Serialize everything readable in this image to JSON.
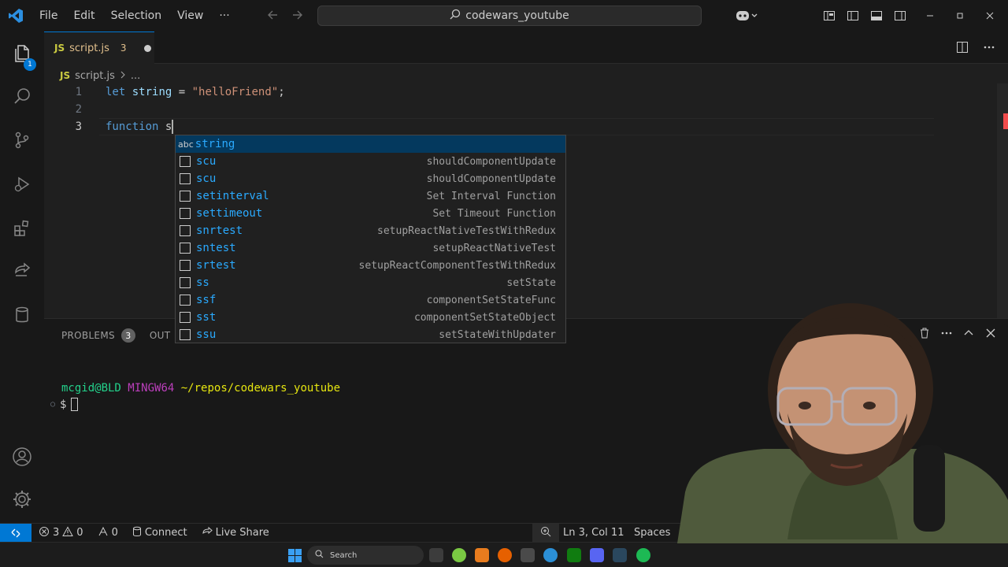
{
  "menu": {
    "file": "File",
    "edit": "Edit",
    "selection": "Selection",
    "view": "View",
    "more": "···"
  },
  "search": {
    "text": "codewars_youtube"
  },
  "activity": {
    "explorer_badge": "1"
  },
  "tab": {
    "lang": "JS",
    "name": "script.js",
    "problem_count": "3"
  },
  "breadcrumb": {
    "lang": "JS",
    "file": "script.js",
    "more": "..."
  },
  "code": {
    "lines": [
      {
        "number": "1",
        "content": ""
      },
      {
        "number": "2",
        "content": ""
      },
      {
        "number": "3",
        "content": ""
      }
    ],
    "line1": {
      "kw": "let",
      "var": "string",
      "eq": " = ",
      "str": "\"helloFriend\"",
      "end": ";"
    },
    "line3": {
      "kw": "function",
      "typed": "s"
    }
  },
  "suggest": {
    "items": [
      {
        "icon": "abc",
        "label": "string",
        "detail": ""
      },
      {
        "icon": "snippet",
        "label": "scu",
        "detail": "shouldComponentUpdate"
      },
      {
        "icon": "snippet",
        "label": "scu",
        "detail": "shouldComponentUpdate"
      },
      {
        "icon": "snippet",
        "label": "setinterval",
        "detail": "Set Interval Function"
      },
      {
        "icon": "snippet",
        "label": "settimeout",
        "detail": "Set Timeout Function"
      },
      {
        "icon": "snippet",
        "label": "snrtest",
        "detail": "setupReactNativeTestWithRedux"
      },
      {
        "icon": "snippet",
        "label": "sntest",
        "detail": "setupReactNativeTest"
      },
      {
        "icon": "snippet",
        "label": "srtest",
        "detail": "setupReactComponentTestWithRedux"
      },
      {
        "icon": "snippet",
        "label": "ss",
        "detail": "setState"
      },
      {
        "icon": "snippet",
        "label": "ssf",
        "detail": "componentSetStateFunc"
      },
      {
        "icon": "snippet",
        "label": "sst",
        "detail": "componentSetStateObject"
      },
      {
        "icon": "snippet",
        "label": "ssu",
        "detail": "setStateWithUpdater"
      }
    ]
  },
  "panel": {
    "problems_label": "PROBLEMS",
    "problems_count": "3",
    "output_label": "OUT",
    "terminal": {
      "user": "mcgid@BLD",
      "host": "MINGW64",
      "path": "~/repos/codewars_youtube",
      "prompt": "$"
    }
  },
  "status": {
    "errors": "3",
    "warnings": "0",
    "ports": "0",
    "connect": "Connect",
    "live_share": "Live Share",
    "position": "Ln 3, Col 11",
    "spaces": "Spaces"
  },
  "taskbar": {
    "search": "Search"
  },
  "colors": {
    "accent": "#0078d4",
    "keyword": "#569cd6",
    "string": "#ce9178",
    "variable": "#9cdcfe",
    "error": "#f14c4c"
  }
}
